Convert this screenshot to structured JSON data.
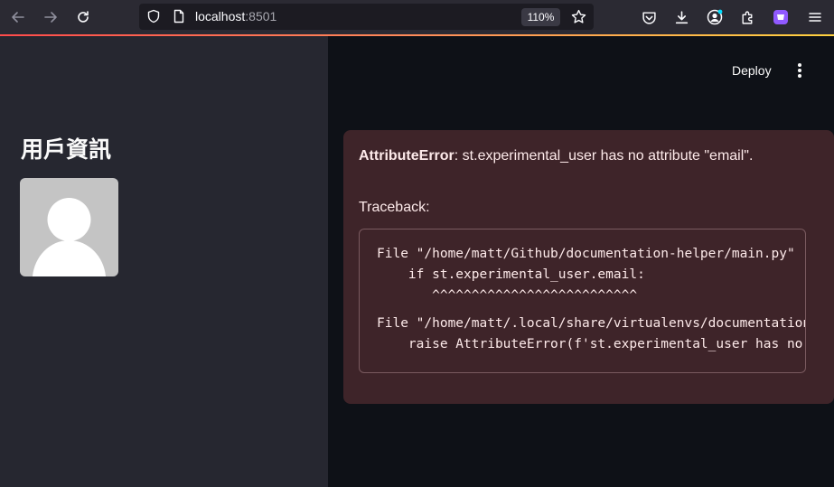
{
  "browser": {
    "url_host": "localhost",
    "url_port": ":8501",
    "zoom": "110%",
    "icons": {
      "back": "arrow-left-icon",
      "forward": "arrow-right-icon",
      "reload": "reload-icon",
      "shield": "shield-icon",
      "page": "page-icon",
      "bookmark": "star-icon",
      "pocket": "pocket-icon",
      "downloads": "download-icon",
      "account": "account-icon",
      "extensions": "puzzle-icon",
      "extension_purple": "extension-icon",
      "menu": "hamburger-menu-icon"
    }
  },
  "app": {
    "deploy_label": "Deploy",
    "sidebar": {
      "title": "用戶資訊"
    },
    "error": {
      "type": "AttributeError",
      "message": ": st.experimental_user has no attribute \"email\".",
      "traceback_label": "Traceback:",
      "lines": [
        "File \"/home/matt/Github/documentation-helper/main.py\"",
        "    if st.experimental_user.email:",
        "       ^^^^^^^^^^^^^^^^^^^^^^^^^^",
        "File \"/home/matt/.local/share/virtualenvs/documentation-helper\"",
        "    raise AttributeError(f'st.experimental_user has no attribute')"
      ]
    }
  },
  "colors": {
    "sidebar_bg": "#262730",
    "main_bg": "#0e1117",
    "error_bg": "#3e2429",
    "error_text": "#fdeaea",
    "accent": "#ff4b4b"
  }
}
